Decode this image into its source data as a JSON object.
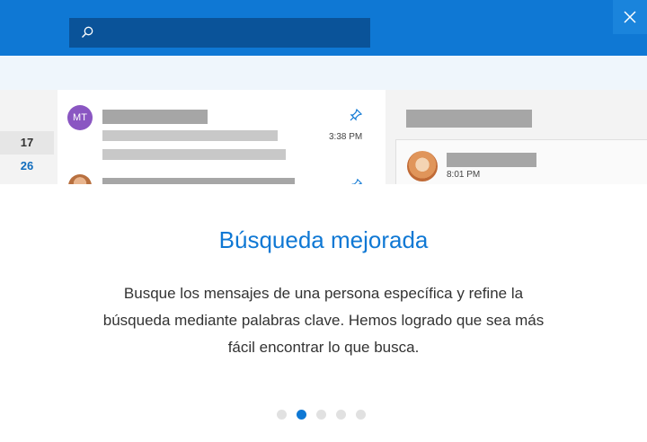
{
  "header": {
    "search": {
      "placeholder": ""
    },
    "close_label": "close"
  },
  "preview": {
    "dates": [
      "17",
      "26"
    ],
    "message1": {
      "avatar_initials": "MT",
      "time": "3:38 PM"
    },
    "reading": {
      "time": "8:01 PM"
    }
  },
  "dialog": {
    "title": "Búsqueda mejorada",
    "description": "Busque los mensajes de una persona específica y refine la búsqueda mediante palabras clave. Hemos logrado que sea más fácil encontrar lo que busca.",
    "pagination": {
      "total": 5,
      "active_index": 1
    }
  },
  "colors": {
    "accent": "#0f78d4",
    "avatar_mt": "#8a56c2"
  },
  "icons": [
    "search-icon",
    "close-icon",
    "pin-icon"
  ]
}
